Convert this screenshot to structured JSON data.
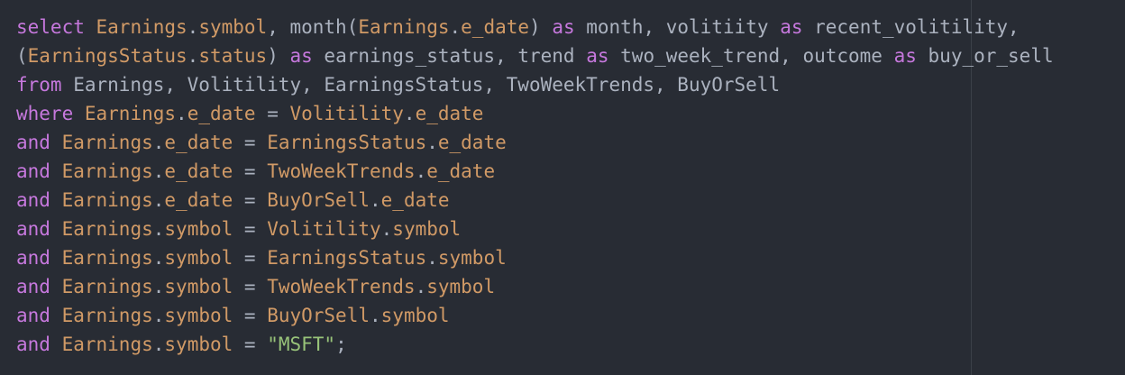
{
  "editor": {
    "colors": {
      "background": "#282c34",
      "keyword": "#c678dd",
      "identifier": "#d19a66",
      "plain": "#abb2bf",
      "string": "#98c379",
      "wrap_guide": "#3b4048"
    },
    "lines": [
      [
        {
          "t": "kw",
          "v": "select"
        },
        {
          "t": "pl",
          "v": " "
        },
        {
          "t": "id",
          "v": "Earnings"
        },
        {
          "t": "pl",
          "v": "."
        },
        {
          "t": "id",
          "v": "symbol"
        },
        {
          "t": "pl",
          "v": ", month("
        },
        {
          "t": "id",
          "v": "Earnings"
        },
        {
          "t": "pl",
          "v": "."
        },
        {
          "t": "id",
          "v": "e_date"
        },
        {
          "t": "pl",
          "v": ") "
        },
        {
          "t": "kw",
          "v": "as"
        },
        {
          "t": "pl",
          "v": " month, volitiity "
        },
        {
          "t": "kw",
          "v": "as"
        },
        {
          "t": "pl",
          "v": " recent_volitility,"
        }
      ],
      [
        {
          "t": "pl",
          "v": "("
        },
        {
          "t": "id",
          "v": "EarningsStatus"
        },
        {
          "t": "pl",
          "v": "."
        },
        {
          "t": "id",
          "v": "status"
        },
        {
          "t": "pl",
          "v": ") "
        },
        {
          "t": "kw",
          "v": "as"
        },
        {
          "t": "pl",
          "v": " earnings_status, trend "
        },
        {
          "t": "kw",
          "v": "as"
        },
        {
          "t": "pl",
          "v": " two_week_trend, outcome "
        },
        {
          "t": "kw",
          "v": "as"
        },
        {
          "t": "pl",
          "v": " buy_or_sell"
        }
      ],
      [
        {
          "t": "kw",
          "v": "from"
        },
        {
          "t": "pl",
          "v": " Earnings, Volitility, EarningsStatus, TwoWeekTrends, BuyOrSell"
        }
      ],
      [
        {
          "t": "kw",
          "v": "where"
        },
        {
          "t": "pl",
          "v": " "
        },
        {
          "t": "id",
          "v": "Earnings"
        },
        {
          "t": "pl",
          "v": "."
        },
        {
          "t": "id",
          "v": "e_date"
        },
        {
          "t": "pl",
          "v": " = "
        },
        {
          "t": "id",
          "v": "Volitility"
        },
        {
          "t": "pl",
          "v": "."
        },
        {
          "t": "id",
          "v": "e_date"
        }
      ],
      [
        {
          "t": "kw",
          "v": "and"
        },
        {
          "t": "pl",
          "v": " "
        },
        {
          "t": "id",
          "v": "Earnings"
        },
        {
          "t": "pl",
          "v": "."
        },
        {
          "t": "id",
          "v": "e_date"
        },
        {
          "t": "pl",
          "v": " = "
        },
        {
          "t": "id",
          "v": "EarningsStatus"
        },
        {
          "t": "pl",
          "v": "."
        },
        {
          "t": "id",
          "v": "e_date"
        }
      ],
      [
        {
          "t": "kw",
          "v": "and"
        },
        {
          "t": "pl",
          "v": " "
        },
        {
          "t": "id",
          "v": "Earnings"
        },
        {
          "t": "pl",
          "v": "."
        },
        {
          "t": "id",
          "v": "e_date"
        },
        {
          "t": "pl",
          "v": " = "
        },
        {
          "t": "id",
          "v": "TwoWeekTrends"
        },
        {
          "t": "pl",
          "v": "."
        },
        {
          "t": "id",
          "v": "e_date"
        }
      ],
      [
        {
          "t": "kw",
          "v": "and"
        },
        {
          "t": "pl",
          "v": " "
        },
        {
          "t": "id",
          "v": "Earnings"
        },
        {
          "t": "pl",
          "v": "."
        },
        {
          "t": "id",
          "v": "e_date"
        },
        {
          "t": "pl",
          "v": " = "
        },
        {
          "t": "id",
          "v": "BuyOrSell"
        },
        {
          "t": "pl",
          "v": "."
        },
        {
          "t": "id",
          "v": "e_date"
        }
      ],
      [
        {
          "t": "kw",
          "v": "and"
        },
        {
          "t": "pl",
          "v": " "
        },
        {
          "t": "id",
          "v": "Earnings"
        },
        {
          "t": "pl",
          "v": "."
        },
        {
          "t": "id",
          "v": "symbol"
        },
        {
          "t": "pl",
          "v": " = "
        },
        {
          "t": "id",
          "v": "Volitility"
        },
        {
          "t": "pl",
          "v": "."
        },
        {
          "t": "id",
          "v": "symbol"
        }
      ],
      [
        {
          "t": "kw",
          "v": "and"
        },
        {
          "t": "pl",
          "v": " "
        },
        {
          "t": "id",
          "v": "Earnings"
        },
        {
          "t": "pl",
          "v": "."
        },
        {
          "t": "id",
          "v": "symbol"
        },
        {
          "t": "pl",
          "v": " = "
        },
        {
          "t": "id",
          "v": "EarningsStatus"
        },
        {
          "t": "pl",
          "v": "."
        },
        {
          "t": "id",
          "v": "symbol"
        }
      ],
      [
        {
          "t": "kw",
          "v": "and"
        },
        {
          "t": "pl",
          "v": " "
        },
        {
          "t": "id",
          "v": "Earnings"
        },
        {
          "t": "pl",
          "v": "."
        },
        {
          "t": "id",
          "v": "symbol"
        },
        {
          "t": "pl",
          "v": " = "
        },
        {
          "t": "id",
          "v": "TwoWeekTrends"
        },
        {
          "t": "pl",
          "v": "."
        },
        {
          "t": "id",
          "v": "symbol"
        }
      ],
      [
        {
          "t": "kw",
          "v": "and"
        },
        {
          "t": "pl",
          "v": " "
        },
        {
          "t": "id",
          "v": "Earnings"
        },
        {
          "t": "pl",
          "v": "."
        },
        {
          "t": "id",
          "v": "symbol"
        },
        {
          "t": "pl",
          "v": " = "
        },
        {
          "t": "id",
          "v": "BuyOrSell"
        },
        {
          "t": "pl",
          "v": "."
        },
        {
          "t": "id",
          "v": "symbol"
        }
      ],
      [
        {
          "t": "kw",
          "v": "and"
        },
        {
          "t": "pl",
          "v": " "
        },
        {
          "t": "id",
          "v": "Earnings"
        },
        {
          "t": "pl",
          "v": "."
        },
        {
          "t": "id",
          "v": "symbol"
        },
        {
          "t": "pl",
          "v": " = "
        },
        {
          "t": "str",
          "v": "\"MSFT\""
        },
        {
          "t": "pl",
          "v": ";"
        }
      ]
    ]
  }
}
